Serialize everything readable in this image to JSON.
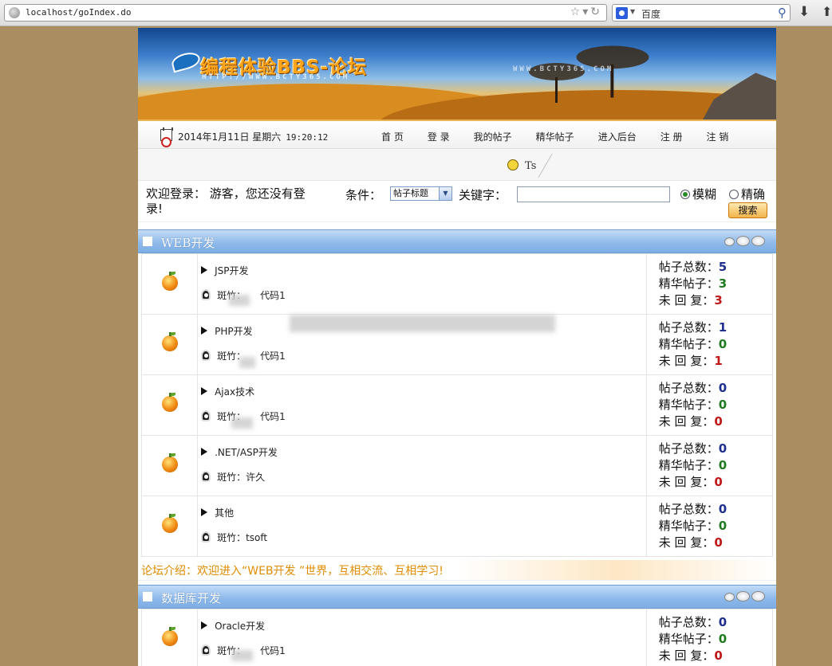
{
  "browser": {
    "url": "localhost/goIndex.do",
    "search_engine": "百度"
  },
  "header": {
    "logo_title": "编程体验BBS-论坛",
    "logo_url": "HTTP://WWW.BCTY365.COM",
    "watermark": "WWW.BCTY365.COM"
  },
  "nav": {
    "date": "2014年1月11日 星期六",
    "time": "19:20:12",
    "items": [
      "首 页",
      "登 录",
      "我的帖子",
      "精华帖子",
      "进入后台",
      "注 册",
      "注 销"
    ]
  },
  "notice": {
    "text": "Ts"
  },
  "login": {
    "welcome": "欢迎登录： 游客，您还没有登录!",
    "condition_label": "条件：",
    "condition_value": "帖子标题",
    "keyword_label": "关键字：",
    "keyword_value": "",
    "radio_fuzzy": "模糊",
    "radio_exact": "精确",
    "search_button": "搜索"
  },
  "stat_labels": {
    "total": "帖子总数：",
    "elite": "精华帖子：",
    "unreplied": "未 回 复："
  },
  "sections": [
    {
      "title": "WEB开发",
      "intro": "论坛介绍：欢迎进入“WEB开发 ”世界，互相交流、互相学习!",
      "forums": [
        {
          "name": "JSP开发",
          "moderator": "斑竹：　　代码1",
          "total": "5",
          "elite": "3",
          "unreplied": "3"
        },
        {
          "name": "PHP开发",
          "moderator": "斑竹：　　代码1",
          "total": "1",
          "elite": "0",
          "unreplied": "1"
        },
        {
          "name": "Ajax技术",
          "moderator": "斑竹：　　代码1",
          "total": "0",
          "elite": "0",
          "unreplied": "0"
        },
        {
          "name": ".NET/ASP开发",
          "moderator": "斑竹：许久",
          "total": "0",
          "elite": "0",
          "unreplied": "0"
        },
        {
          "name": "其他",
          "moderator": "斑竹：tsoft",
          "total": "0",
          "elite": "0",
          "unreplied": "0"
        }
      ]
    },
    {
      "title": "数据库开发",
      "forums": [
        {
          "name": "Oracle开发",
          "moderator": "斑竹：　　代码1",
          "total": "0",
          "elite": "0",
          "unreplied": "0"
        }
      ]
    }
  ]
}
